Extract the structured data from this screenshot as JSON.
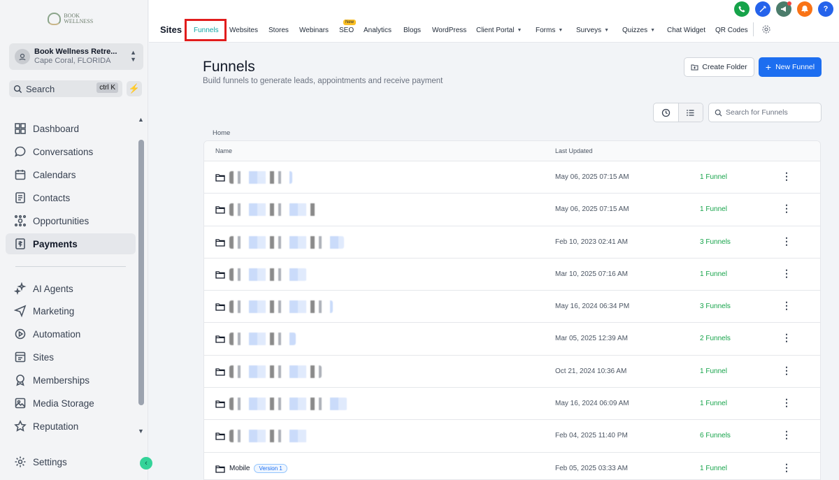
{
  "sidebar": {
    "logo_text": "BOOK WELLNESS",
    "location_name": "Book Wellness Retre...",
    "location_city": "Cape Coral, FLORIDA",
    "search_label": "Search",
    "search_shortcut": "ctrl K",
    "items": [
      {
        "label": "Dashboard",
        "icon": "dashboard-icon"
      },
      {
        "label": "Conversations",
        "icon": "chat-icon"
      },
      {
        "label": "Calendars",
        "icon": "calendar-icon"
      },
      {
        "label": "Contacts",
        "icon": "contacts-icon"
      },
      {
        "label": "Opportunities",
        "icon": "opportunities-icon"
      },
      {
        "label": "Payments",
        "icon": "payments-icon",
        "active": true
      },
      {
        "label": "AI Agents",
        "icon": "sparkle-icon"
      },
      {
        "label": "Marketing",
        "icon": "send-icon"
      },
      {
        "label": "Automation",
        "icon": "automation-icon"
      },
      {
        "label": "Sites",
        "icon": "sites-icon"
      },
      {
        "label": "Memberships",
        "icon": "badge-icon"
      },
      {
        "label": "Media Storage",
        "icon": "image-icon"
      },
      {
        "label": "Reputation",
        "icon": "star-icon"
      },
      {
        "label": "Settings",
        "icon": "gear-icon"
      }
    ]
  },
  "topbar": {
    "section_title": "Sites",
    "tabs": [
      {
        "label": "Funnels",
        "active": true
      },
      {
        "label": "Websites"
      },
      {
        "label": "Stores"
      },
      {
        "label": "Webinars"
      },
      {
        "label": "SEO",
        "badge": "New"
      },
      {
        "label": "Analytics"
      },
      {
        "label": "Blogs"
      },
      {
        "label": "WordPress"
      },
      {
        "label": "Client Portal",
        "dropdown": true
      },
      {
        "label": "Forms",
        "dropdown": true
      },
      {
        "label": "Surveys",
        "dropdown": true
      },
      {
        "label": "Quizzes",
        "dropdown": true
      },
      {
        "label": "Chat Widget"
      },
      {
        "label": "QR Codes"
      }
    ],
    "icons": [
      {
        "name": "phone-icon",
        "color": "#16a34a"
      },
      {
        "name": "magic-icon",
        "color": "#2563eb"
      },
      {
        "name": "megaphone-icon",
        "color": "#4b7c6b"
      },
      {
        "name": "bell-icon",
        "color": "#f97316"
      },
      {
        "name": "help-icon",
        "color": "#2563eb"
      }
    ]
  },
  "main": {
    "title": "Funnels",
    "subtitle": "Build funnels to generate leads, appointments and receive payment",
    "create_folder_label": "Create Folder",
    "new_funnel_label": "New Funnel",
    "search_placeholder": "Search for Funnels",
    "breadcrumb": "Home",
    "columns": {
      "name": "Name",
      "updated": "Last Updated"
    },
    "rows": [
      {
        "name": "",
        "updated": "May 06, 2025 07:15 AM",
        "count": "1 Funnel"
      },
      {
        "name": "",
        "updated": "May 06, 2025 07:15 AM",
        "count": "1 Funnel"
      },
      {
        "name": "",
        "updated": "Feb 10, 2023 02:41 AM",
        "count": "3 Funnels"
      },
      {
        "name": "",
        "updated": "Mar 10, 2025 07:16 AM",
        "count": "1 Funnel"
      },
      {
        "name": "",
        "updated": "May 16, 2024 06:34 PM",
        "count": "3 Funnels"
      },
      {
        "name": "",
        "updated": "Mar 05, 2025 12:39 AM",
        "count": "2 Funnels"
      },
      {
        "name": "",
        "updated": "Oct 21, 2024 10:36 AM",
        "count": "1 Funnel"
      },
      {
        "name": "",
        "updated": "May 16, 2024 06:09 AM",
        "count": "1 Funnel"
      },
      {
        "name": "",
        "updated": "Feb 04, 2025 11:40 PM",
        "count": "6 Funnels"
      },
      {
        "name": "Mobile",
        "badge": "Version 1",
        "updated": "Feb 05, 2025 03:33 AM",
        "count": "1 Funnel"
      }
    ]
  }
}
